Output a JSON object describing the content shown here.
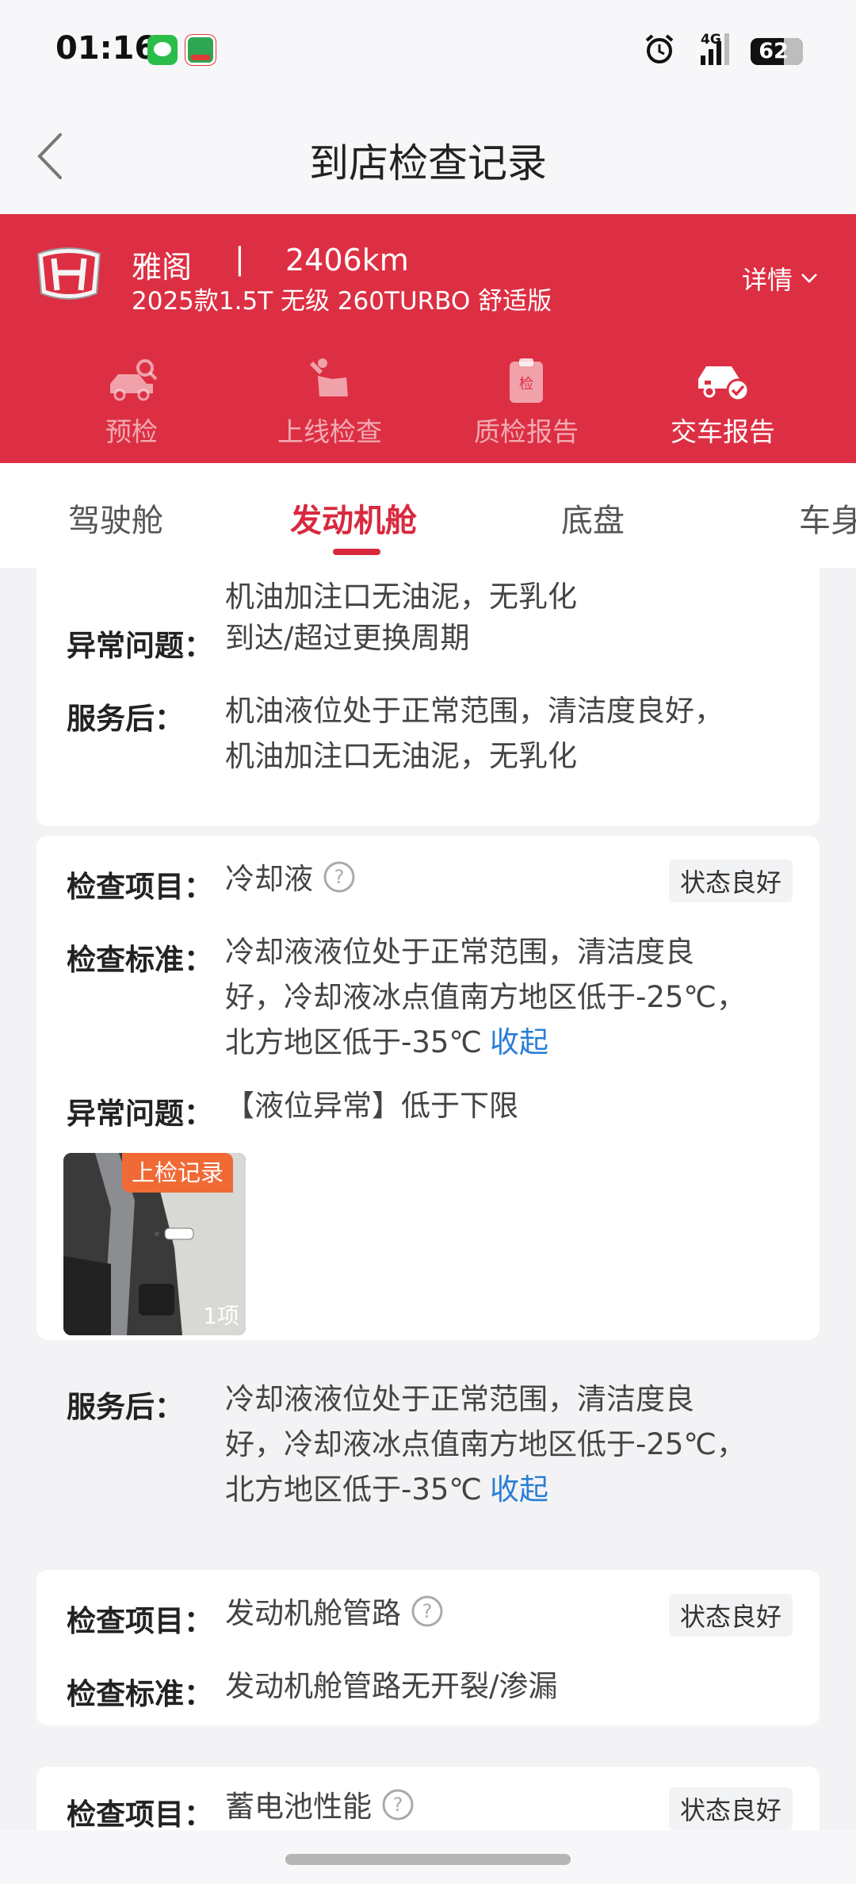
{
  "status_bar": {
    "time": "01:16",
    "network": "4G",
    "battery": "62"
  },
  "header": {
    "title": "到店检查记录"
  },
  "car": {
    "model": "雅阁",
    "separator": "|",
    "mileage": "2406km",
    "variant": "2025款1.5T 无级 260TURBO 舒适版",
    "details_label": "详情"
  },
  "stages": [
    {
      "label": "预检",
      "icon": "car-search-icon"
    },
    {
      "label": "上线检查",
      "icon": "mechanic-icon"
    },
    {
      "label": "质检报告",
      "icon": "clipboard-icon",
      "badge": "检"
    },
    {
      "label": "交车报告",
      "icon": "car-check-icon",
      "active": true
    }
  ],
  "tabs": [
    {
      "label": "驾驶舱"
    },
    {
      "label": "发动机舱",
      "active": true
    },
    {
      "label": "底盘"
    },
    {
      "label": "车身"
    }
  ],
  "items": {
    "oil_partial": {
      "standard_tail": "机油加注口无油泥，无乳化",
      "issue_label": "异常问题：",
      "issue_value": "到达/超过更换周期",
      "after_label": "服务后：",
      "after_line1": "机油液位处于正常范围，清洁度良好，",
      "after_line2": "机油加注口无油泥，无乳化"
    },
    "coolant": {
      "item_label": "检查项目：",
      "item_value": "冷却液",
      "status": "状态良好",
      "standard_label": "检查标准：",
      "standard_line1": "冷却液液位处于正常范围，清洁度良",
      "standard_line2": "好，冷却液冰点值南方地区低于-25℃，",
      "standard_line3": "北方地区低于-35℃",
      "collapse_label": "收起",
      "issue_label": "异常问题：",
      "issue_value": "【液位异常】低于下限",
      "photo_tag": "上检记录",
      "photo_count": "1项",
      "after_label": "服务后：",
      "after_line1": "冷却液液位处于正常范围，清洁度良",
      "after_line2": "好，冷却液冰点值南方地区低于-25℃，",
      "after_line3": "北方地区低于-35℃",
      "after_collapse_label": "收起"
    },
    "hoses": {
      "item_label": "检查项目：",
      "item_value": "发动机舱管路",
      "status": "状态良好",
      "standard_label": "检查标准：",
      "standard_value": "发动机舱管路无开裂/渗漏"
    },
    "battery": {
      "item_label": "检查项目：",
      "item_value": "蓄电池性能",
      "status": "状态良好"
    }
  },
  "colors": {
    "brand_red": "#dd2f43",
    "tab_active": "#d8293f",
    "link_blue": "#2a7fd4",
    "photo_tag": "#f06a36"
  }
}
